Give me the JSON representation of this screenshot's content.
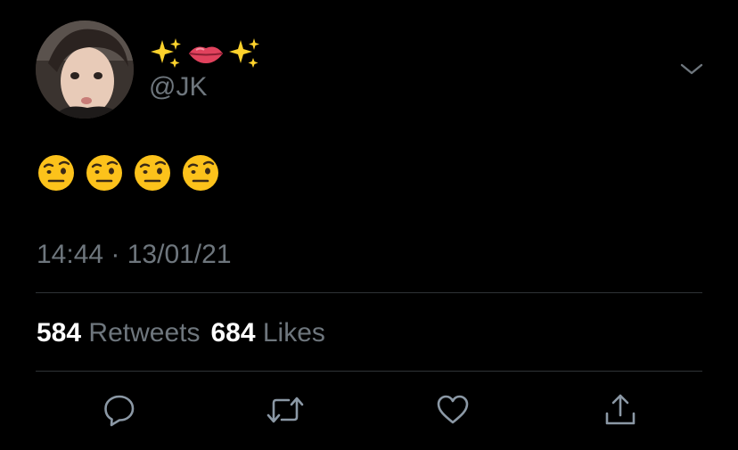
{
  "tweet": {
    "display_name_emojis": [
      "sparkles",
      "lips",
      "sparkles"
    ],
    "handle": "@JK",
    "body_emojis": [
      "face-with-raised-eyebrow",
      "face-with-raised-eyebrow",
      "face-with-raised-eyebrow",
      "face-with-raised-eyebrow"
    ],
    "timestamp": "14:44 · 13/01/21"
  },
  "stats": {
    "retweets_count": "584",
    "retweets_label": "Retweets",
    "likes_count": "684",
    "likes_label": "Likes"
  },
  "actions": {
    "reply_icon": "reply-icon",
    "retweet_icon": "retweet-icon",
    "like_icon": "heart-icon",
    "share_icon": "share-icon"
  },
  "colors": {
    "background": "#000000",
    "primary_text": "#ffffff",
    "secondary_text": "#6e767d",
    "divider": "#2f3336"
  }
}
